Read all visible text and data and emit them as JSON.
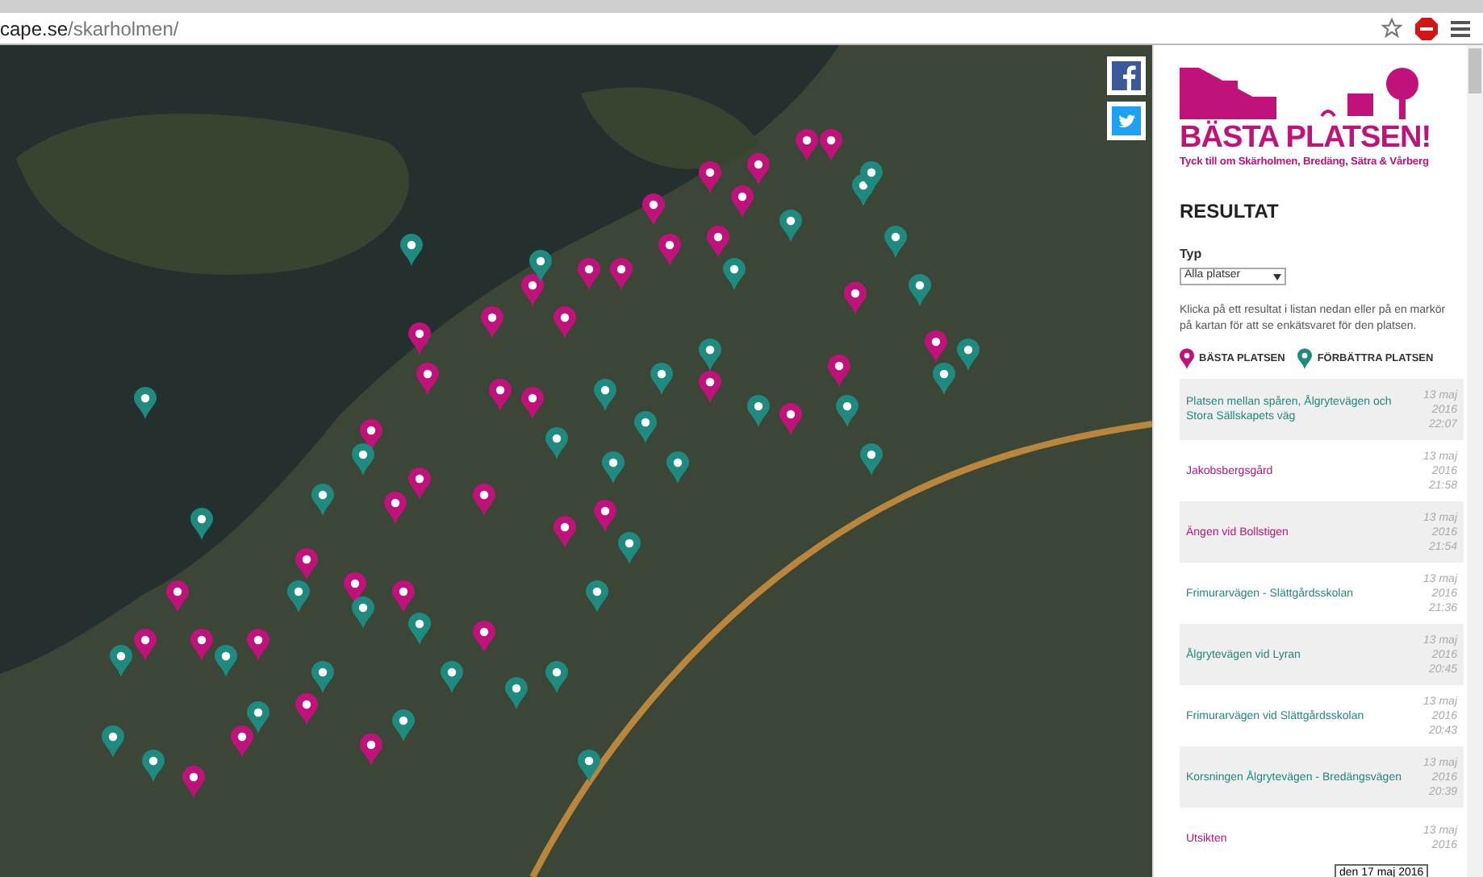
{
  "browser": {
    "url_host": "cape.se",
    "url_path": "/skarholmen/"
  },
  "map": {
    "markers": [
      {
        "kind": "basta"
      },
      {
        "kind": "basta"
      },
      {
        "kind": "basta"
      },
      {
        "kind": "basta"
      },
      {
        "kind": "basta"
      },
      {
        "kind": "basta"
      },
      {
        "kind": "basta"
      },
      {
        "kind": "basta"
      },
      {
        "kind": "basta"
      },
      {
        "kind": "basta"
      },
      {
        "kind": "basta"
      },
      {
        "kind": "basta"
      },
      {
        "kind": "basta"
      },
      {
        "kind": "basta"
      },
      {
        "kind": "basta"
      },
      {
        "kind": "basta"
      },
      {
        "kind": "basta"
      },
      {
        "kind": "basta"
      },
      {
        "kind": "basta"
      },
      {
        "kind": "basta"
      },
      {
        "kind": "basta"
      },
      {
        "kind": "basta"
      },
      {
        "kind": "basta"
      },
      {
        "kind": "basta"
      },
      {
        "kind": "basta"
      },
      {
        "kind": "basta"
      },
      {
        "kind": "basta"
      },
      {
        "kind": "basta"
      },
      {
        "kind": "basta"
      },
      {
        "kind": "basta"
      },
      {
        "kind": "basta"
      },
      {
        "kind": "basta"
      },
      {
        "kind": "basta"
      },
      {
        "kind": "basta"
      },
      {
        "kind": "basta"
      },
      {
        "kind": "basta"
      },
      {
        "kind": "basta"
      },
      {
        "kind": "basta"
      },
      {
        "kind": "basta"
      },
      {
        "kind": "basta"
      },
      {
        "kind": "forbattra"
      },
      {
        "kind": "forbattra"
      },
      {
        "kind": "forbattra"
      },
      {
        "kind": "forbattra"
      },
      {
        "kind": "forbattra"
      },
      {
        "kind": "forbattra"
      },
      {
        "kind": "forbattra"
      },
      {
        "kind": "forbattra"
      },
      {
        "kind": "forbattra"
      },
      {
        "kind": "forbattra"
      },
      {
        "kind": "forbattra"
      },
      {
        "kind": "forbattra"
      },
      {
        "kind": "forbattra"
      },
      {
        "kind": "forbattra"
      },
      {
        "kind": "forbattra"
      },
      {
        "kind": "forbattra"
      },
      {
        "kind": "forbattra"
      },
      {
        "kind": "forbattra"
      },
      {
        "kind": "forbattra"
      },
      {
        "kind": "forbattra"
      },
      {
        "kind": "forbattra"
      },
      {
        "kind": "forbattra"
      },
      {
        "kind": "forbattra"
      },
      {
        "kind": "forbattra"
      },
      {
        "kind": "forbattra"
      },
      {
        "kind": "forbattra"
      },
      {
        "kind": "forbattra"
      },
      {
        "kind": "forbattra"
      },
      {
        "kind": "forbattra"
      },
      {
        "kind": "forbattra"
      },
      {
        "kind": "forbattra"
      },
      {
        "kind": "forbattra"
      },
      {
        "kind": "forbattra"
      },
      {
        "kind": "forbattra"
      },
      {
        "kind": "forbattra"
      },
      {
        "kind": "forbattra"
      },
      {
        "kind": "forbattra"
      },
      {
        "kind": "forbattra"
      },
      {
        "kind": "forbattra"
      },
      {
        "kind": "forbattra"
      }
    ]
  },
  "social": [
    {
      "kind": "facebook"
    },
    {
      "kind": "twitter"
    }
  ],
  "logo": {
    "title": "BÄSTA PLATSEN!",
    "subtitle": "Tyck till om Skärholmen, Bredäng, Sätra & Vårberg"
  },
  "heading": "RESULTAT",
  "filter": {
    "label": "Typ",
    "value": "Alla platser"
  },
  "instructions": "Klicka på ett resultat i listan nedan eller på en markör på kartan för att se enkätsvaret för den platsen.",
  "legend": [
    {
      "kind": "basta",
      "label": "BÄSTA PLATSEN"
    },
    {
      "kind": "forbattra",
      "label": "FÖRBÄTTRA PLATSEN"
    }
  ],
  "results": [
    {
      "kind": "forbattra",
      "title": "Platsen mellan spåren, Ålgrytevägen och Stora Sällskapets väg",
      "date": "13 maj 2016 22:07"
    },
    {
      "kind": "basta",
      "title": "Jakobsbergsgård",
      "date": "13 maj 2016 21:58"
    },
    {
      "kind": "basta",
      "title": "Ängen vid Bollstigen",
      "date": "13 maj 2016 21:54"
    },
    {
      "kind": "forbattra",
      "title": "Frimurarvägen - Slättgårdsskolan",
      "date": "13 maj 2016 21:36"
    },
    {
      "kind": "forbattra",
      "title": "Ålgrytevägen vid Lyran",
      "date": "13 maj 2016 20:45"
    },
    {
      "kind": "forbattra",
      "title": "Frimurarvägen vid Slättgårdsskolan",
      "date": "13 maj 2016 20:43"
    },
    {
      "kind": "forbattra",
      "title": "Korsningen Ålgrytevägen - Bredängsvägen",
      "date": "13 maj 2016 20:39"
    },
    {
      "kind": "basta",
      "title": "Utsikten",
      "date": "13 maj 2016"
    }
  ],
  "tooltip": "den 17 maj 2016"
}
